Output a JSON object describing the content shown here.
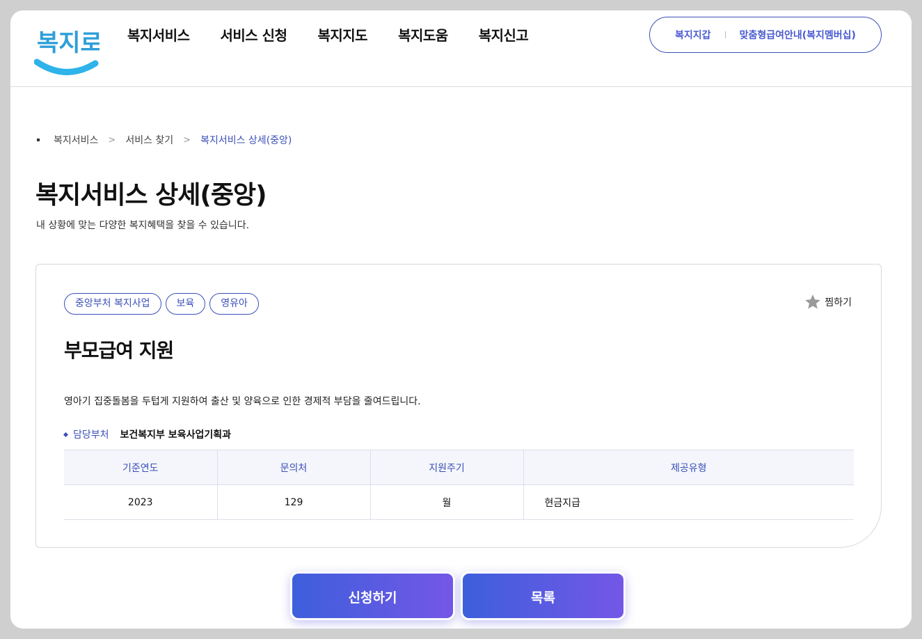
{
  "logo": {
    "text": "복지로",
    "colors": {
      "text": "#2e9fd8",
      "smile": "#2eb3ea"
    }
  },
  "gnb": [
    "복지서비스",
    "서비스 신청",
    "복지지도",
    "복지도움",
    "복지신고"
  ],
  "util": {
    "wallet": "복지지갑",
    "membership": "맞춤형급여안내(복지멤버십)"
  },
  "breadcrumb": {
    "items": [
      "복지서비스",
      "서비스 찾기"
    ],
    "current": "복지서비스 상세(중앙)"
  },
  "page": {
    "title": "복지서비스 상세(중앙)",
    "description": "내 상황에 맞는 다양한 복지혜택을 찾을 수 있습니다."
  },
  "service": {
    "tags": [
      "중앙부처 복지사업",
      "보육",
      "영유아"
    ],
    "favorite_label": "찜하기",
    "title": "부모급여 지원",
    "description": "영아기 집중돌봄을 두텁게 지원하여 출산 및 양육으로 인한 경제적 부담을 줄여드립니다.",
    "dept_label": "담당부처",
    "dept_value": "보건복지부 보육사업기획과",
    "table": {
      "headers": [
        "기준연도",
        "문의처",
        "지원주기",
        "제공유형"
      ],
      "row": [
        "2023",
        "129",
        "월",
        "현금지급"
      ]
    }
  },
  "buttons": {
    "apply": "신청하기",
    "list": "목록"
  },
  "colors": {
    "accent": "#3b4fb8",
    "button_start": "#3d5fdc",
    "button_end": "#7457e6"
  }
}
